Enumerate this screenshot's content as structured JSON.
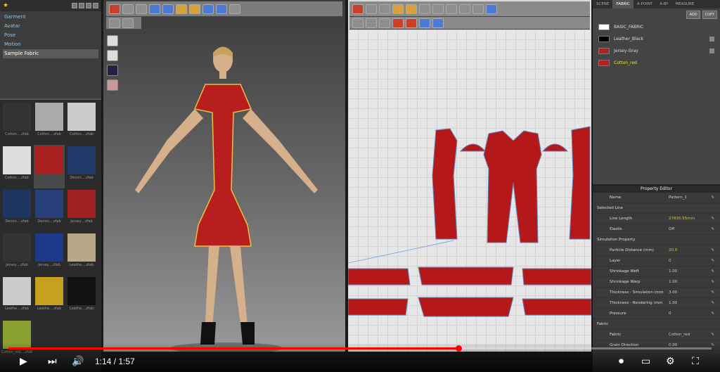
{
  "library": {
    "items": [
      {
        "label": "Garment"
      },
      {
        "label": "Avatar"
      },
      {
        "label": "Pose"
      },
      {
        "label": "Motion"
      },
      {
        "label": "Sample Fabric"
      }
    ],
    "thumbs": [
      {
        "cap": "Cotton....zfab",
        "color": "#333"
      },
      {
        "cap": "Cotton....zfab",
        "color": "#aaa"
      },
      {
        "cap": "Cotton....zfab",
        "color": "#ccc"
      },
      {
        "cap": "Cotton....zfab",
        "color": "#ddd"
      },
      {
        "cap": "",
        "color": "#a82020"
      },
      {
        "cap": "Denim....zfab",
        "color": "#223a6a"
      },
      {
        "cap": "Denim....zfab",
        "color": "#1d3560"
      },
      {
        "cap": "Denim....zfab",
        "color": "#28407a"
      },
      {
        "cap": "Jersey....zfab",
        "color": "#a02020"
      },
      {
        "cap": "Jersey....zfab",
        "color": "#333"
      },
      {
        "cap": "Jersey....zfab",
        "color": "#1c3a8a"
      },
      {
        "cap": "Leathe....zfab",
        "color": "#b8a888"
      },
      {
        "cap": "Leathe....zfab",
        "color": "#ccc"
      },
      {
        "cap": "Leathe....zfab",
        "color": "#c8a020"
      },
      {
        "cap": "Leathe....zfab",
        "color": "#111"
      },
      {
        "cap": "Cotton_red....zfab",
        "color": "#8aa030"
      },
      {
        "cap": "",
        "color": "#2b2b2b"
      },
      {
        "cap": "",
        "color": "#2b2b2b"
      }
    ]
  },
  "rightpanel": {
    "tabs": [
      "SCENE",
      "FABRIC",
      "A-POINT",
      "A-BY",
      "MEASURE"
    ],
    "add": "ADD",
    "copy": "COPY",
    "fabrics": [
      {
        "name": "BASIC_FABRIC",
        "color": "#ffffff"
      },
      {
        "name": "Leather_Black",
        "color": "#000000"
      },
      {
        "name": "Jersey-Gray",
        "color": "#b22222"
      },
      {
        "name": "Cotton_red",
        "color": "#b22222"
      }
    ]
  },
  "props": {
    "title": "Property Editor",
    "rows": [
      {
        "k": "Name",
        "v": "Pattern_1",
        "sec": false,
        "w": true
      },
      {
        "k": "Selected Line",
        "v": "",
        "sec": true
      },
      {
        "k": "Line Length",
        "v": "27835.55mm",
        "sec": false
      },
      {
        "k": "Elastic",
        "v": "Off",
        "sec": false,
        "w": true
      },
      {
        "k": "Simulation Property",
        "v": "",
        "sec": true
      },
      {
        "k": "Particle Distance (mm)",
        "v": "20.0",
        "sec": false
      },
      {
        "k": "Layer",
        "v": "0",
        "sec": false
      },
      {
        "k": "Shrinkage Weft",
        "v": "1.00",
        "sec": false,
        "w": true
      },
      {
        "k": "Shrinkage Warp",
        "v": "1.00",
        "sec": false,
        "w": true
      },
      {
        "k": "Thickness - Simulation (mm",
        "v": "3.00",
        "sec": false,
        "w": true
      },
      {
        "k": "Thickness - Rendering (mm",
        "v": "1.00",
        "sec": false,
        "w": true
      },
      {
        "k": "Pressure",
        "v": "0",
        "sec": false,
        "w": true
      },
      {
        "k": "Fabric",
        "v": "",
        "sec": true
      },
      {
        "k": "Fabric",
        "v": "Cotton_red",
        "sec": false,
        "w": true
      },
      {
        "k": "Grain Direction",
        "v": "0.00",
        "sec": false,
        "w": true
      }
    ]
  },
  "video": {
    "time": "1:14 / 1:57",
    "progress": 0.64
  }
}
